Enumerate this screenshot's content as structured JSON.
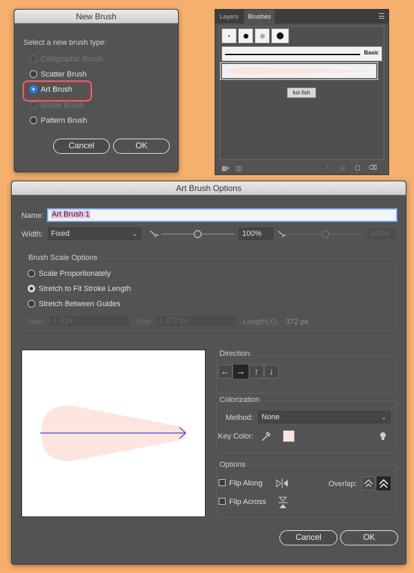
{
  "new_brush": {
    "title": "New Brush",
    "prompt": "Select a new brush type:",
    "options": [
      {
        "label": "Calligraphic Brush",
        "state": "disabled"
      },
      {
        "label": "Scatter Brush",
        "state": "enabled"
      },
      {
        "label": "Art Brush",
        "state": "selected"
      },
      {
        "label": "Bristle Brush",
        "state": "disabled"
      },
      {
        "label": "Pattern Brush",
        "state": "enabled"
      }
    ],
    "cancel_label": "Cancel",
    "ok_label": "OK"
  },
  "brushes_panel": {
    "tabs": [
      "Layers",
      "Brushes"
    ],
    "active_tab": "Brushes",
    "basic_label": "Basic",
    "tooltip": "koi fish"
  },
  "art_brush": {
    "title": "Art Brush Options",
    "name_label": "Name:",
    "name_value": "Art Brush 1",
    "width_label": "Width:",
    "width_value": "Fixed",
    "width_percent": "100%",
    "width_percent_disabled": "100%",
    "scale_options": {
      "title": "Brush Scale Options",
      "options": [
        {
          "label": "Scale Proportionately",
          "selected": false
        },
        {
          "label": "Stretch to Fit Stroke Length",
          "selected": true
        },
        {
          "label": "Stretch Between Guides",
          "selected": false
        }
      ],
      "start_label": "Start:",
      "start_value": "0 px",
      "end_label": "End:",
      "end_value": "372 px",
      "length_label": "Length(X):",
      "length_value": "372 px"
    },
    "direction": {
      "title": "Direction:",
      "arrows": [
        "←",
        "→",
        "↑",
        "↓"
      ],
      "selected": "→"
    },
    "colorization": {
      "title": "Colorization",
      "method_label": "Method:",
      "method_value": "None",
      "key_color_label": "Key Color:",
      "key_color": "#fde5df"
    },
    "options": {
      "title": "Options",
      "flip_along": "Flip Along",
      "flip_across": "Flip Across",
      "overlap_label": "Overlap:"
    },
    "cancel_label": "Cancel",
    "ok_label": "OK"
  },
  "colors": {
    "background": "#f5b06e",
    "dialog": "#535353",
    "brush_fill": "#fde5df",
    "selected_radio": "#2a84f0",
    "highlight_ring": "#c8323c",
    "direction_arrow": "#3f3fd8"
  }
}
